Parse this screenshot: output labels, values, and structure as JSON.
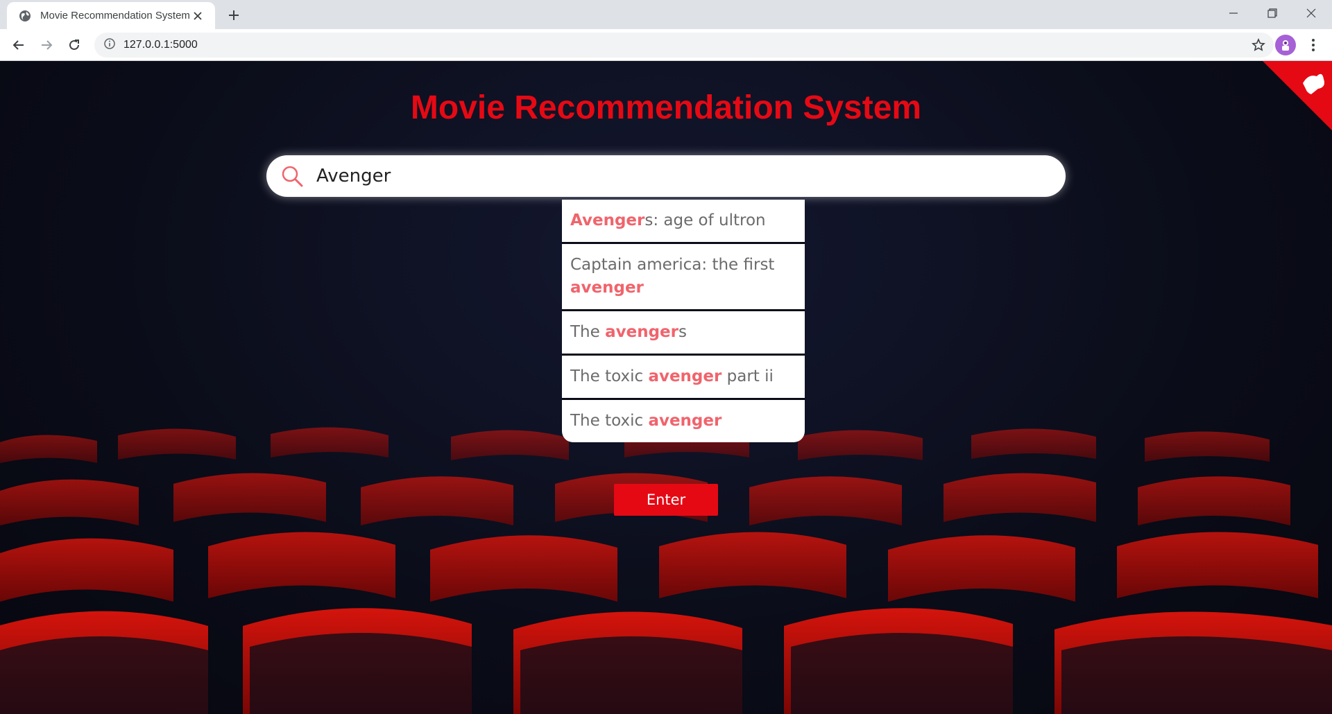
{
  "browser": {
    "tab_title": "Movie Recommendation System",
    "url": "127.0.0.1:5000"
  },
  "page": {
    "title": "Movie Recommendation System",
    "search": {
      "value": "Avenger"
    },
    "suggestions": [
      {
        "parts": [
          {
            "t": "Avenger",
            "hl": true
          },
          {
            "t": "s: age of ultron",
            "hl": false
          }
        ]
      },
      {
        "parts": [
          {
            "t": "Captain america: the first ",
            "hl": false
          },
          {
            "t": "avenger",
            "hl": true
          }
        ]
      },
      {
        "parts": [
          {
            "t": "The ",
            "hl": false
          },
          {
            "t": "avenger",
            "hl": true
          },
          {
            "t": "s",
            "hl": false
          }
        ]
      },
      {
        "parts": [
          {
            "t": "The toxic ",
            "hl": false
          },
          {
            "t": "avenger",
            "hl": true
          },
          {
            "t": " part ii",
            "hl": false
          }
        ]
      },
      {
        "parts": [
          {
            "t": "The toxic ",
            "hl": false
          },
          {
            "t": "avenger",
            "hl": true
          }
        ]
      }
    ],
    "enter_label": "Enter"
  },
  "colors": {
    "brand_red": "#e50914",
    "highlight": "#f0646c"
  },
  "icons": [
    "globe-icon",
    "close-icon",
    "plus-icon",
    "minimize-icon",
    "restore-icon",
    "window-close-icon",
    "back-icon",
    "forward-icon",
    "reload-icon",
    "info-icon",
    "star-icon",
    "avatar-icon",
    "menu-icon",
    "github-corner-icon",
    "search-icon"
  ]
}
